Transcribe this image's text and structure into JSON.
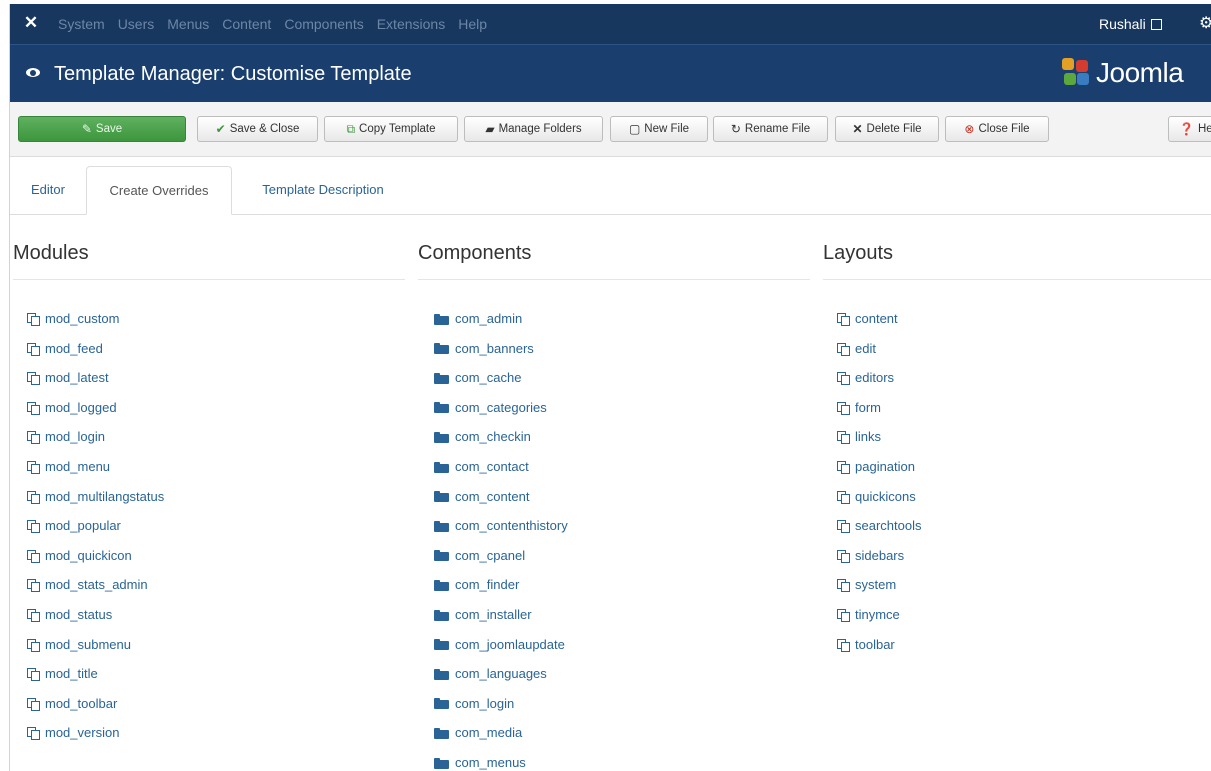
{
  "topnav": {
    "menu": [
      "System",
      "Users",
      "Menus",
      "Content",
      "Components",
      "Extensions",
      "Help"
    ],
    "user": "Rushali"
  },
  "title": {
    "text": "Template Manager: Customise Template",
    "logo_text": "Joomla"
  },
  "toolbar": {
    "save": "Save",
    "save_close": "Save & Close",
    "copy_template": "Copy Template",
    "manage_folders": "Manage Folders",
    "new_file": "New File",
    "rename_file": "Rename File",
    "delete_file": "Delete File",
    "close_file": "Close File",
    "help": "Hel"
  },
  "tabs": [
    "Editor",
    "Create Overrides",
    "Template Description"
  ],
  "columns": {
    "modules": {
      "heading": "Modules",
      "items": [
        "mod_custom",
        "mod_feed",
        "mod_latest",
        "mod_logged",
        "mod_login",
        "mod_menu",
        "mod_multilangstatus",
        "mod_popular",
        "mod_quickicon",
        "mod_stats_admin",
        "mod_status",
        "mod_submenu",
        "mod_title",
        "mod_toolbar",
        "mod_version"
      ]
    },
    "components": {
      "heading": "Components",
      "items": [
        "com_admin",
        "com_banners",
        "com_cache",
        "com_categories",
        "com_checkin",
        "com_contact",
        "com_content",
        "com_contenthistory",
        "com_cpanel",
        "com_finder",
        "com_installer",
        "com_joomlaupdate",
        "com_languages",
        "com_login",
        "com_media",
        "com_menus"
      ]
    },
    "layouts": {
      "heading": "Layouts",
      "items": [
        "content",
        "edit",
        "editors",
        "form",
        "links",
        "pagination",
        "quickicons",
        "searchtools",
        "sidebars",
        "system",
        "tinymce",
        "toolbar"
      ]
    }
  },
  "colors": {
    "nav_bg": "#17375e",
    "title_bg": "#1a3f6e",
    "save_green": "#46a546",
    "link_blue": "#2a6496"
  }
}
